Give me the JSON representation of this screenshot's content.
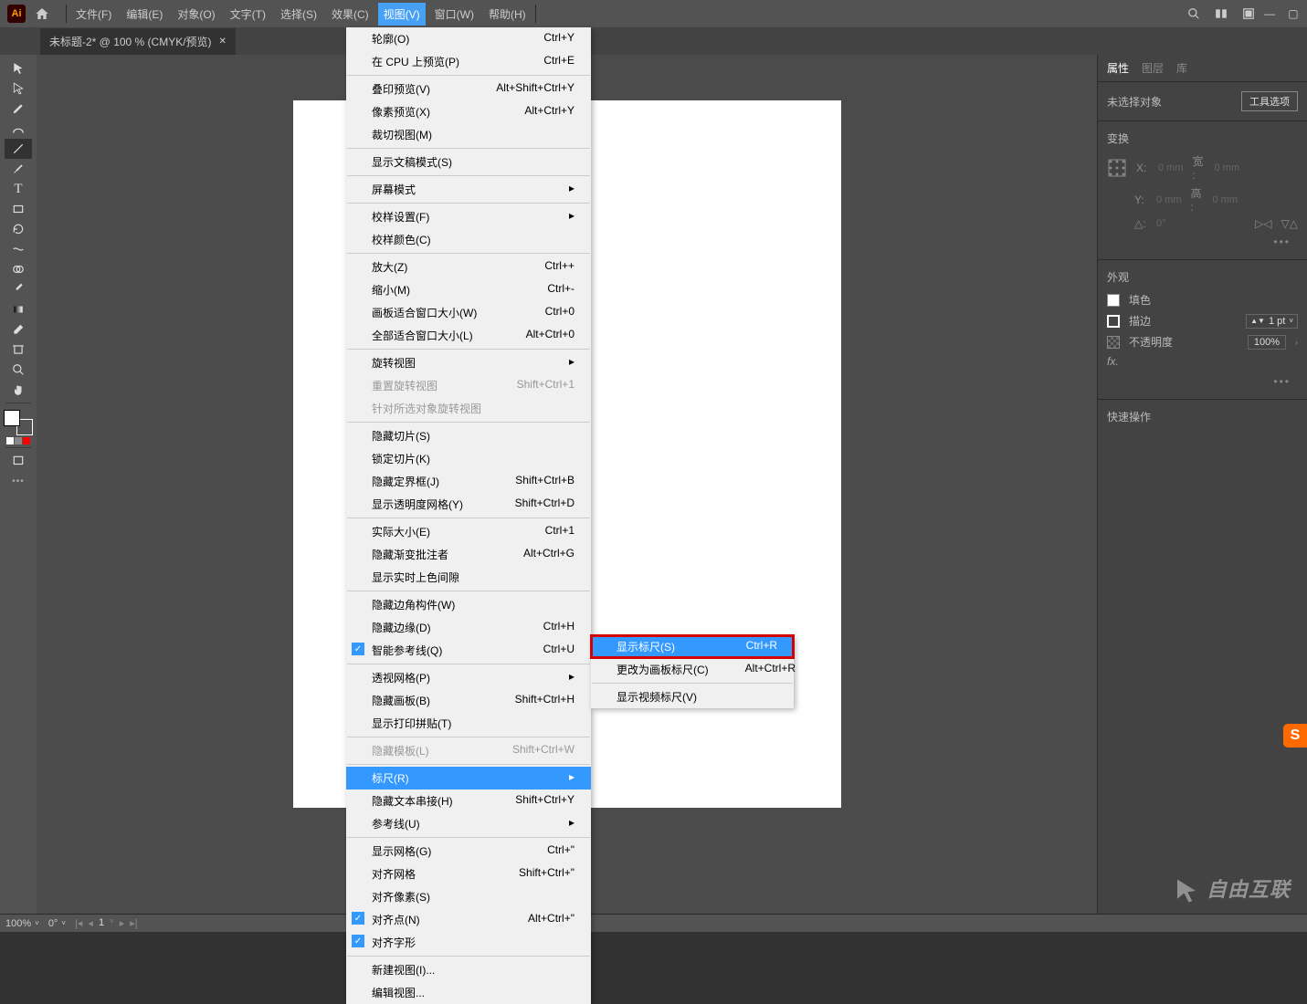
{
  "app": {
    "name": "Ai"
  },
  "menubar": [
    "文件(F)",
    "编辑(E)",
    "对象(O)",
    "文字(T)",
    "选择(S)",
    "效果(C)",
    "视图(V)",
    "窗口(W)",
    "帮助(H)"
  ],
  "menubar_active_index": 6,
  "tab": {
    "title": "未标题-2* @ 100 % (CMYK/预览)"
  },
  "view_menu": [
    {
      "label": "轮廓(O)",
      "shortcut": "Ctrl+Y"
    },
    {
      "label": "在 CPU 上预览(P)",
      "shortcut": "Ctrl+E"
    },
    {
      "sep": true
    },
    {
      "label": "叠印预览(V)",
      "shortcut": "Alt+Shift+Ctrl+Y"
    },
    {
      "label": "像素预览(X)",
      "shortcut": "Alt+Ctrl+Y"
    },
    {
      "label": "裁切视图(M)"
    },
    {
      "sep": true
    },
    {
      "label": "显示文稿模式(S)"
    },
    {
      "sep": true
    },
    {
      "label": "屏幕模式",
      "submenu": true
    },
    {
      "sep": true
    },
    {
      "label": "校样设置(F)",
      "submenu": true
    },
    {
      "label": "校样颜色(C)"
    },
    {
      "sep": true
    },
    {
      "label": "放大(Z)",
      "shortcut": "Ctrl++"
    },
    {
      "label": "缩小(M)",
      "shortcut": "Ctrl+-"
    },
    {
      "label": "画板适合窗口大小(W)",
      "shortcut": "Ctrl+0"
    },
    {
      "label": "全部适合窗口大小(L)",
      "shortcut": "Alt+Ctrl+0"
    },
    {
      "sep": true
    },
    {
      "label": "旋转视图",
      "submenu": true
    },
    {
      "label": "重置旋转视图",
      "shortcut": "Shift+Ctrl+1",
      "disabled": true
    },
    {
      "label": "针对所选对象旋转视图",
      "disabled": true
    },
    {
      "sep": true
    },
    {
      "label": "隐藏切片(S)"
    },
    {
      "label": "锁定切片(K)"
    },
    {
      "label": "隐藏定界框(J)",
      "shortcut": "Shift+Ctrl+B"
    },
    {
      "label": "显示透明度网格(Y)",
      "shortcut": "Shift+Ctrl+D"
    },
    {
      "sep": true
    },
    {
      "label": "实际大小(E)",
      "shortcut": "Ctrl+1"
    },
    {
      "label": "隐藏渐变批注者",
      "shortcut": "Alt+Ctrl+G"
    },
    {
      "label": "显示实时上色间隙"
    },
    {
      "sep": true
    },
    {
      "label": "隐藏边角构件(W)"
    },
    {
      "label": "隐藏边缘(D)",
      "shortcut": "Ctrl+H"
    },
    {
      "label": "智能参考线(Q)",
      "shortcut": "Ctrl+U",
      "check": true
    },
    {
      "sep": true
    },
    {
      "label": "透视网格(P)",
      "submenu": true
    },
    {
      "label": "隐藏画板(B)",
      "shortcut": "Shift+Ctrl+H"
    },
    {
      "label": "显示打印拼贴(T)"
    },
    {
      "sep": true
    },
    {
      "label": "隐藏模板(L)",
      "shortcut": "Shift+Ctrl+W",
      "disabled": true
    },
    {
      "sep": true
    },
    {
      "label": "标尺(R)",
      "submenu": true,
      "highlight": true
    },
    {
      "label": "隐藏文本串接(H)",
      "shortcut": "Shift+Ctrl+Y"
    },
    {
      "label": "参考线(U)",
      "submenu": true
    },
    {
      "sep": true
    },
    {
      "label": "显示网格(G)",
      "shortcut": "Ctrl+\""
    },
    {
      "label": "对齐网格",
      "shortcut": "Shift+Ctrl+\""
    },
    {
      "label": "对齐像素(S)"
    },
    {
      "label": "对齐点(N)",
      "shortcut": "Alt+Ctrl+\"",
      "check": true
    },
    {
      "label": "对齐字形",
      "check": true
    },
    {
      "sep": true
    },
    {
      "label": "新建视图(I)..."
    },
    {
      "label": "编辑视图..."
    }
  ],
  "submenu": [
    {
      "label": "显示标尺(S)",
      "shortcut": "Ctrl+R",
      "highlight": true
    },
    {
      "label": "更改为画板标尺(C)",
      "shortcut": "Alt+Ctrl+R"
    },
    {
      "sep": true
    },
    {
      "label": "显示视频标尺(V)"
    }
  ],
  "right_panel": {
    "tabs": [
      "属性",
      "图层",
      "库"
    ],
    "no_selection": "未选择对象",
    "tool_options_btn": "工具选项",
    "transform_title": "变换",
    "x_label": "X:",
    "y_label": "Y:",
    "w_label": "宽 :",
    "h_label": "高 :",
    "x_val": "0 mm",
    "y_val": "0 mm",
    "w_val": "0 mm",
    "h_val": "0 mm",
    "angle_label": "△:",
    "angle_val": "0°",
    "appearance_title": "外观",
    "fill_label": "填色",
    "stroke_label": "描边",
    "stroke_val": "1 pt",
    "opacity_label": "不透明度",
    "opacity_val": "100%",
    "fx_label": "fx.",
    "quick_title": "快速操作"
  },
  "statusbar": {
    "zoom": "100%",
    "rotation": "0°",
    "artboard_num": "1"
  },
  "watermark": "自由互联",
  "sogou": "S"
}
